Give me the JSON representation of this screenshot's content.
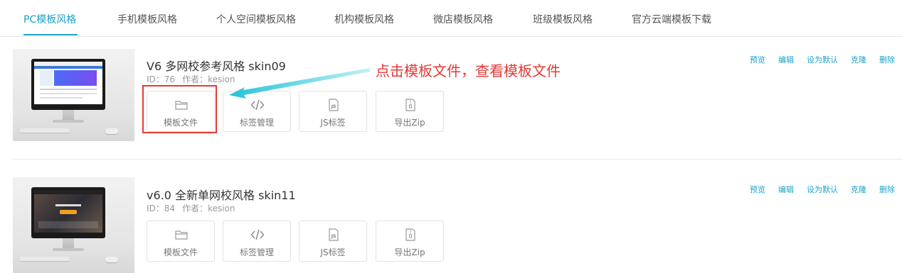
{
  "tabs": [
    {
      "label": "PC模板风格",
      "active": true
    },
    {
      "label": "手机模板风格"
    },
    {
      "label": "个人空间模板风格"
    },
    {
      "label": "机构模板风格"
    },
    {
      "label": "微店模板风格"
    },
    {
      "label": "班级模板风格"
    },
    {
      "label": "官方云端模板下载"
    }
  ],
  "templates": [
    {
      "title": "V6 多网校参考风格 skin09",
      "id_text": "ID：76",
      "author_text": "作者：kesion",
      "buttons": [
        "模板文件",
        "标签管理",
        "JS标签",
        "导出Zip"
      ],
      "actions": [
        "预览",
        "编辑",
        "设为默认",
        "克隆",
        "删除"
      ]
    },
    {
      "title": "v6.0 全新单网校风格 skin11",
      "id_text": "ID：84",
      "author_text": "作者：kesion",
      "buttons": [
        "模板文件",
        "标签管理",
        "JS标签",
        "导出Zip"
      ],
      "actions": [
        "预览",
        "编辑",
        "设为默认",
        "克隆",
        "删除"
      ]
    }
  ],
  "annotation": {
    "text": "点击模板文件，查看模板文件"
  },
  "colors": {
    "accent": "#1ba3c8",
    "annotation": "#e53935"
  },
  "icons": [
    "folder-icon",
    "code-icon",
    "js-file-icon",
    "zip-file-icon"
  ]
}
